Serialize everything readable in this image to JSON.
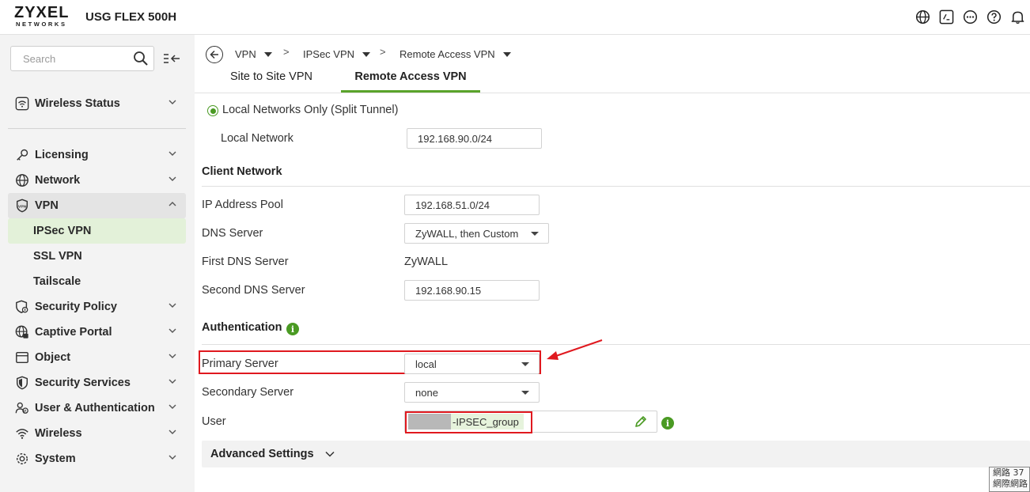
{
  "header": {
    "logo_main": "ZYXEL",
    "logo_sub": "NETWORKS",
    "model": "USG FLEX 500H",
    "icons": [
      "globe-icon",
      "cli-terminal-icon",
      "more-icon",
      "help-icon",
      "bell-icon"
    ]
  },
  "sidebar": {
    "search_placeholder": "Search",
    "top_item": {
      "label": "Wireless Status",
      "icon": "wifi-status-icon"
    },
    "items": [
      {
        "label": "Licensing",
        "icon": "key-icon"
      },
      {
        "label": "Network",
        "icon": "globe-icon"
      },
      {
        "label": "VPN",
        "icon": "vpn-shield-icon"
      },
      {
        "label": "IPSec VPN"
      },
      {
        "label": "SSL VPN"
      },
      {
        "label": "Tailscale"
      },
      {
        "label": "Security Policy",
        "icon": "security-policy-icon"
      },
      {
        "label": "Captive Portal",
        "icon": "captive-portal-icon"
      },
      {
        "label": "Object",
        "icon": "object-icon"
      },
      {
        "label": "Security Services",
        "icon": "security-services-icon"
      },
      {
        "label": "User & Authentication",
        "icon": "users-icon"
      },
      {
        "label": "Wireless",
        "icon": "wifi-icon"
      },
      {
        "label": "System",
        "icon": "gear-icon"
      }
    ]
  },
  "breadcrumb": {
    "items": [
      "VPN",
      "IPSec VPN",
      "Remote Access VPN"
    ],
    "separator": ">"
  },
  "tabs": [
    {
      "label": "Site to Site VPN"
    },
    {
      "label": "Remote Access VPN"
    }
  ],
  "form": {
    "split_tunnel_label": "Local Networks Only (Split Tunnel)",
    "local_network_label": "Local Network",
    "local_network_value": "192.168.90.0/24",
    "client_network_title": "Client Network",
    "ip_pool_label": "IP Address Pool",
    "ip_pool_value": "192.168.51.0/24",
    "dns_server_label": "DNS Server",
    "dns_server_value": "ZyWALL, then Custom",
    "first_dns_label": "First DNS Server",
    "first_dns_value": "ZyWALL",
    "second_dns_label": "Second DNS Server",
    "second_dns_value": "192.168.90.15",
    "auth_title": "Authentication",
    "primary_server_label": "Primary Server",
    "primary_server_value": "local",
    "secondary_server_label": "Secondary Server",
    "secondary_server_value": "none",
    "user_label": "User",
    "user_value": "-IPSEC_group",
    "advanced_label": "Advanced Settings"
  },
  "info_glyph": "i",
  "corner_widget": {
    "line1": "網路 37",
    "line2": "網際網路"
  },
  "colors": {
    "accent_green": "#4a9a23",
    "annotation_red": "#e0191f",
    "selected_bg": "#e3f1d9"
  }
}
